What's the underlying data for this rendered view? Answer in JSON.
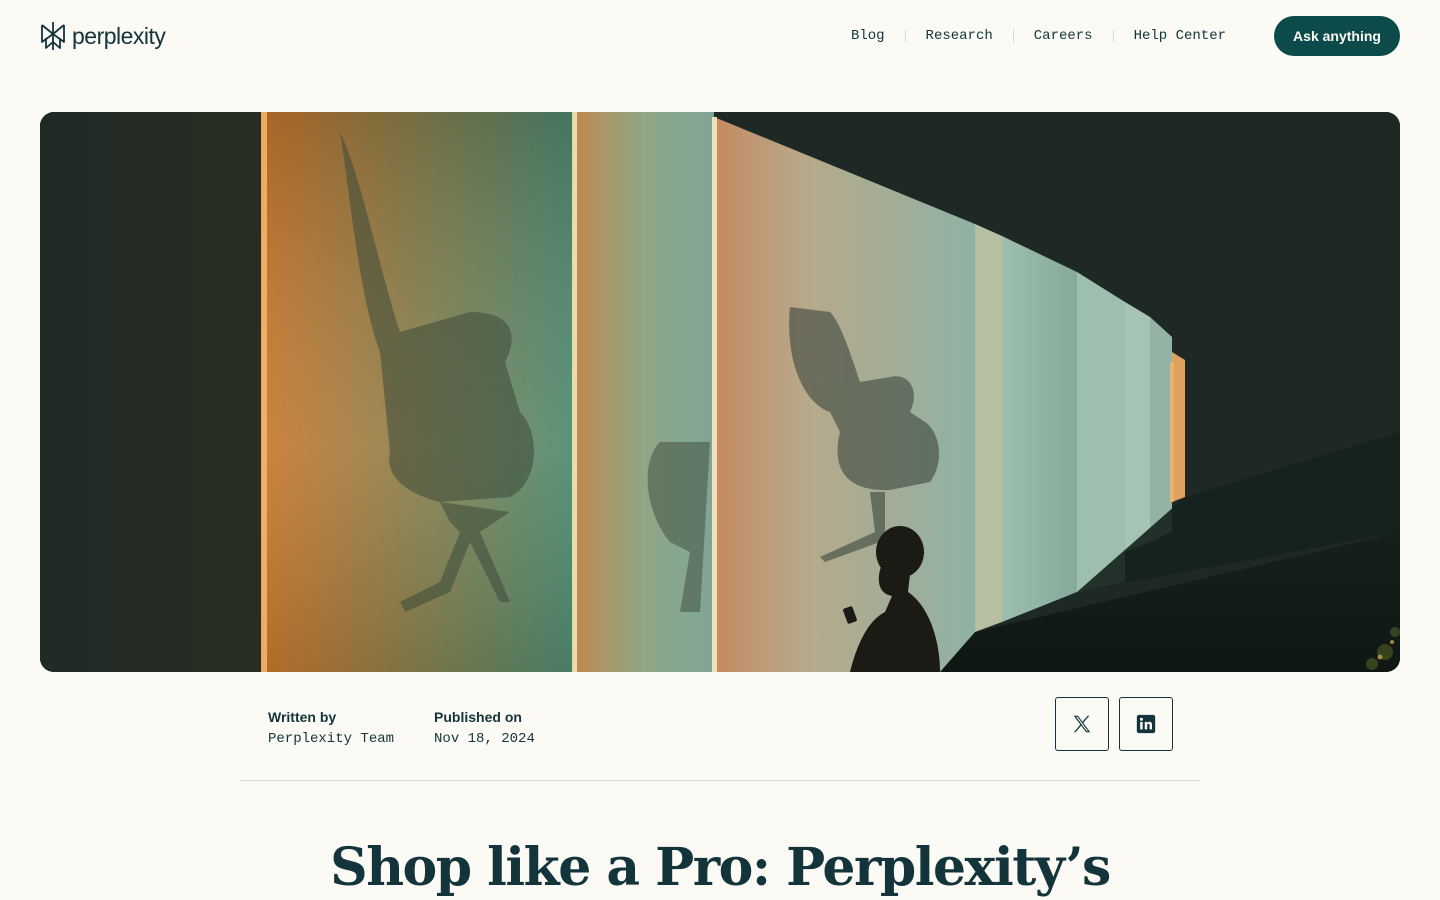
{
  "brand": {
    "name": "perplexity",
    "logo_icon": "perplexity-logo-icon"
  },
  "nav": {
    "items": [
      {
        "label": "Blog"
      },
      {
        "label": "Research"
      },
      {
        "label": "Careers"
      },
      {
        "label": "Help Center"
      }
    ],
    "cta_label": "Ask anything"
  },
  "hero": {
    "image_icon": "hero-image-chairs-silhouette",
    "description": ""
  },
  "article": {
    "author_label": "Written by",
    "author": "Perplexity Team",
    "date_label": "Published on",
    "date": "Nov 18, 2024",
    "share": [
      {
        "icon": "x-logo-icon"
      },
      {
        "icon": "linkedin-icon"
      }
    ],
    "title": "Shop like a Pro: Perplexity’s"
  },
  "colors": {
    "background": "#fbfaf4",
    "ink": "#13343b",
    "cta": "#0d4a4a"
  }
}
